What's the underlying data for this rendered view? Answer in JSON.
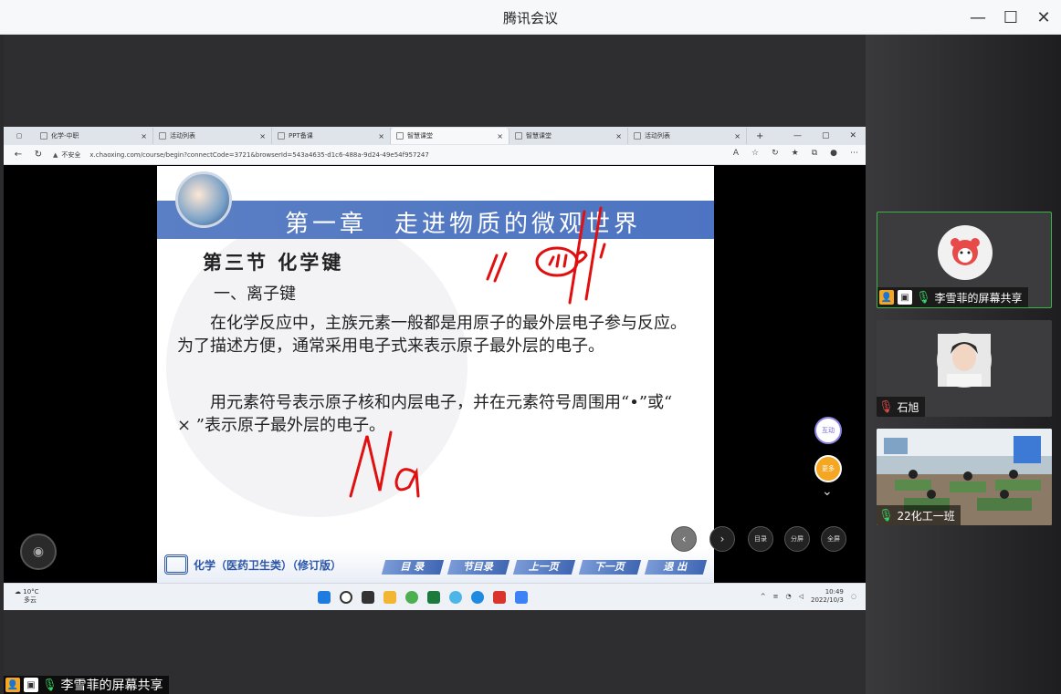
{
  "app": {
    "title": "腾讯会议",
    "controls": {
      "minimize": "—",
      "maximize": "☐",
      "close": "✕"
    }
  },
  "browser": {
    "tabs": [
      {
        "label": "化学-中职",
        "active": false
      },
      {
        "label": "活动列表",
        "active": false
      },
      {
        "label": "PPT备课",
        "active": false
      },
      {
        "label": "智慧课堂",
        "active": true
      },
      {
        "label": "智慧课堂",
        "active": false
      },
      {
        "label": "活动列表",
        "active": false
      }
    ],
    "security": "不安全",
    "url": "x.chaoxing.com/course/begin?connectCode=3721&browserId=543a4635-d1c6-488a-9d24-49e54f957247"
  },
  "slide": {
    "chapter": "第一章　走进物质的微观世界",
    "section": "第三节 化学键",
    "subsection": "一、离子键",
    "para1": "在化学反应中，主族元素一般都是用原子的最外层电子参与反应。为了描述方便，通常采用电子式来表示原子最外层的电子。",
    "para2": "用元素符号表示原子核和内层电子，并在元素符号周围用“•”或“ × ”表示原子最外层的电子。",
    "book_title": "化学（医药卫生类）（修订版）",
    "nav_buttons": [
      "目 录",
      "节目录",
      "上一页",
      "下一页",
      "退 出"
    ],
    "handwriting": "Na"
  },
  "side_controls": {
    "interact": "互动",
    "more": "更多",
    "toc": "目录",
    "split": "分屏",
    "fullscreen": "全屏"
  },
  "taskbar": {
    "temp": "10°C",
    "weather": "多云",
    "time": "10:49",
    "date": "2022/10/3"
  },
  "participants": [
    {
      "name": "李雪菲的屏幕共享",
      "mic": "on",
      "sharing": true
    },
    {
      "name": "石旭",
      "mic": "muted",
      "sharing": false
    },
    {
      "name": "22化工一班",
      "mic": "on",
      "sharing": false
    }
  ],
  "presenter_label": "李雪菲的屏幕共享",
  "colors": {
    "accent_green": "#3bb346",
    "slide_header": "#4d74c2",
    "ink_red": "#e01010"
  }
}
